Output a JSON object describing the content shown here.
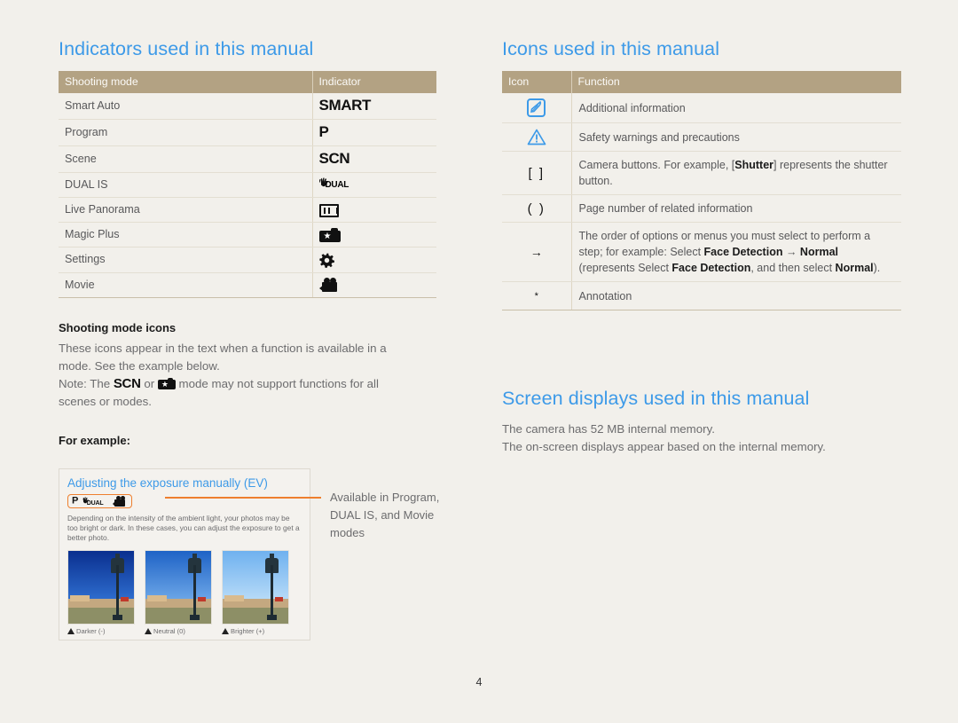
{
  "page": {
    "number": "4",
    "background_color": "#f2f0eb",
    "heading_color": "#3d9ae8",
    "table_header_color": "#b3a283",
    "callout_color": "#ee7f2e"
  },
  "indicators_section": {
    "title": "Indicators used in this manual",
    "table": {
      "headers": [
        "Shooting mode",
        "Indicator"
      ],
      "rows": [
        {
          "mode": "Smart Auto",
          "indicator_text": "SMART",
          "indicator_icon": "smart-text"
        },
        {
          "mode": "Program",
          "indicator_text": "P",
          "indicator_icon": "program-text"
        },
        {
          "mode": "Scene",
          "indicator_text": "SCN",
          "indicator_icon": "scene-text"
        },
        {
          "mode": "DUAL IS",
          "indicator_text": "DUAL",
          "indicator_icon": "dual-is-icon"
        },
        {
          "mode": "Live Panorama",
          "indicator_text": "",
          "indicator_icon": "panorama-icon"
        },
        {
          "mode": "Magic Plus",
          "indicator_text": "",
          "indicator_icon": "magic-plus-camera-star-icon"
        },
        {
          "mode": "Settings",
          "indicator_text": "",
          "indicator_icon": "gear-icon"
        },
        {
          "mode": "Movie",
          "indicator_text": "",
          "indicator_icon": "movie-camera-icon"
        }
      ]
    },
    "shooting_mode_icons": {
      "heading": "Shooting mode icons",
      "line1": "These icons appear in the text when a function is available in a",
      "line2": "mode. See the example below.",
      "note_prefix": "Note: The ",
      "note_scn": "SCN",
      "note_or": " or ",
      "note_suffix": " mode may not support functions for all",
      "note_line2": "scenes or modes."
    },
    "for_example_label": "For example:"
  },
  "example_box": {
    "title": "Adjusting the exposure manually (EV)",
    "mode_icons": [
      "P",
      "DUAL",
      "movie-camera-icon"
    ],
    "description": "Depending on the intensity of the ambient light, your photos may be too bright or dark. In these cases, you can adjust the exposure to get a better photo.",
    "thumbnails": [
      {
        "caption": "Darker (-)",
        "variant": "dark"
      },
      {
        "caption": "Neutral (0)",
        "variant": "mid"
      },
      {
        "caption": "Brighter (+)",
        "variant": "light"
      }
    ]
  },
  "callout": {
    "line1": "Available in Program,",
    "line2": "DUAL IS, and Movie",
    "line3": "modes"
  },
  "icons_section": {
    "title": "Icons used in this manual",
    "table": {
      "headers": [
        "Icon",
        "Function"
      ],
      "rows": [
        {
          "icon": "note-pen-icon",
          "icon_text": "",
          "function_html": "Additional information"
        },
        {
          "icon": "warning-triangle-icon",
          "icon_text": "",
          "function_html": "Safety warnings and precautions"
        },
        {
          "icon": "square-brackets",
          "icon_text": "[ ]",
          "function_html": "Camera buttons. For example, [<b>Shutter</b>] represents the shutter button."
        },
        {
          "icon": "round-brackets",
          "icon_text": "( )",
          "function_html": "Page number of related information"
        },
        {
          "icon": "right-arrow-icon",
          "icon_text": "→",
          "function_html": "The order of options or menus you must select to perform a step; for example: Select <b>Face Detection</b> → <b>Normal</b> (represents Select <b>Face Detection</b>, and then select <b>Normal</b>)."
        },
        {
          "icon": "asterisk",
          "icon_text": "*",
          "function_html": "Annotation"
        }
      ]
    }
  },
  "screen_displays_section": {
    "title": "Screen displays used in this manual",
    "line1": "The camera has 52 MB internal memory.",
    "line2": "The on-screen displays appear based on the internal memory."
  }
}
